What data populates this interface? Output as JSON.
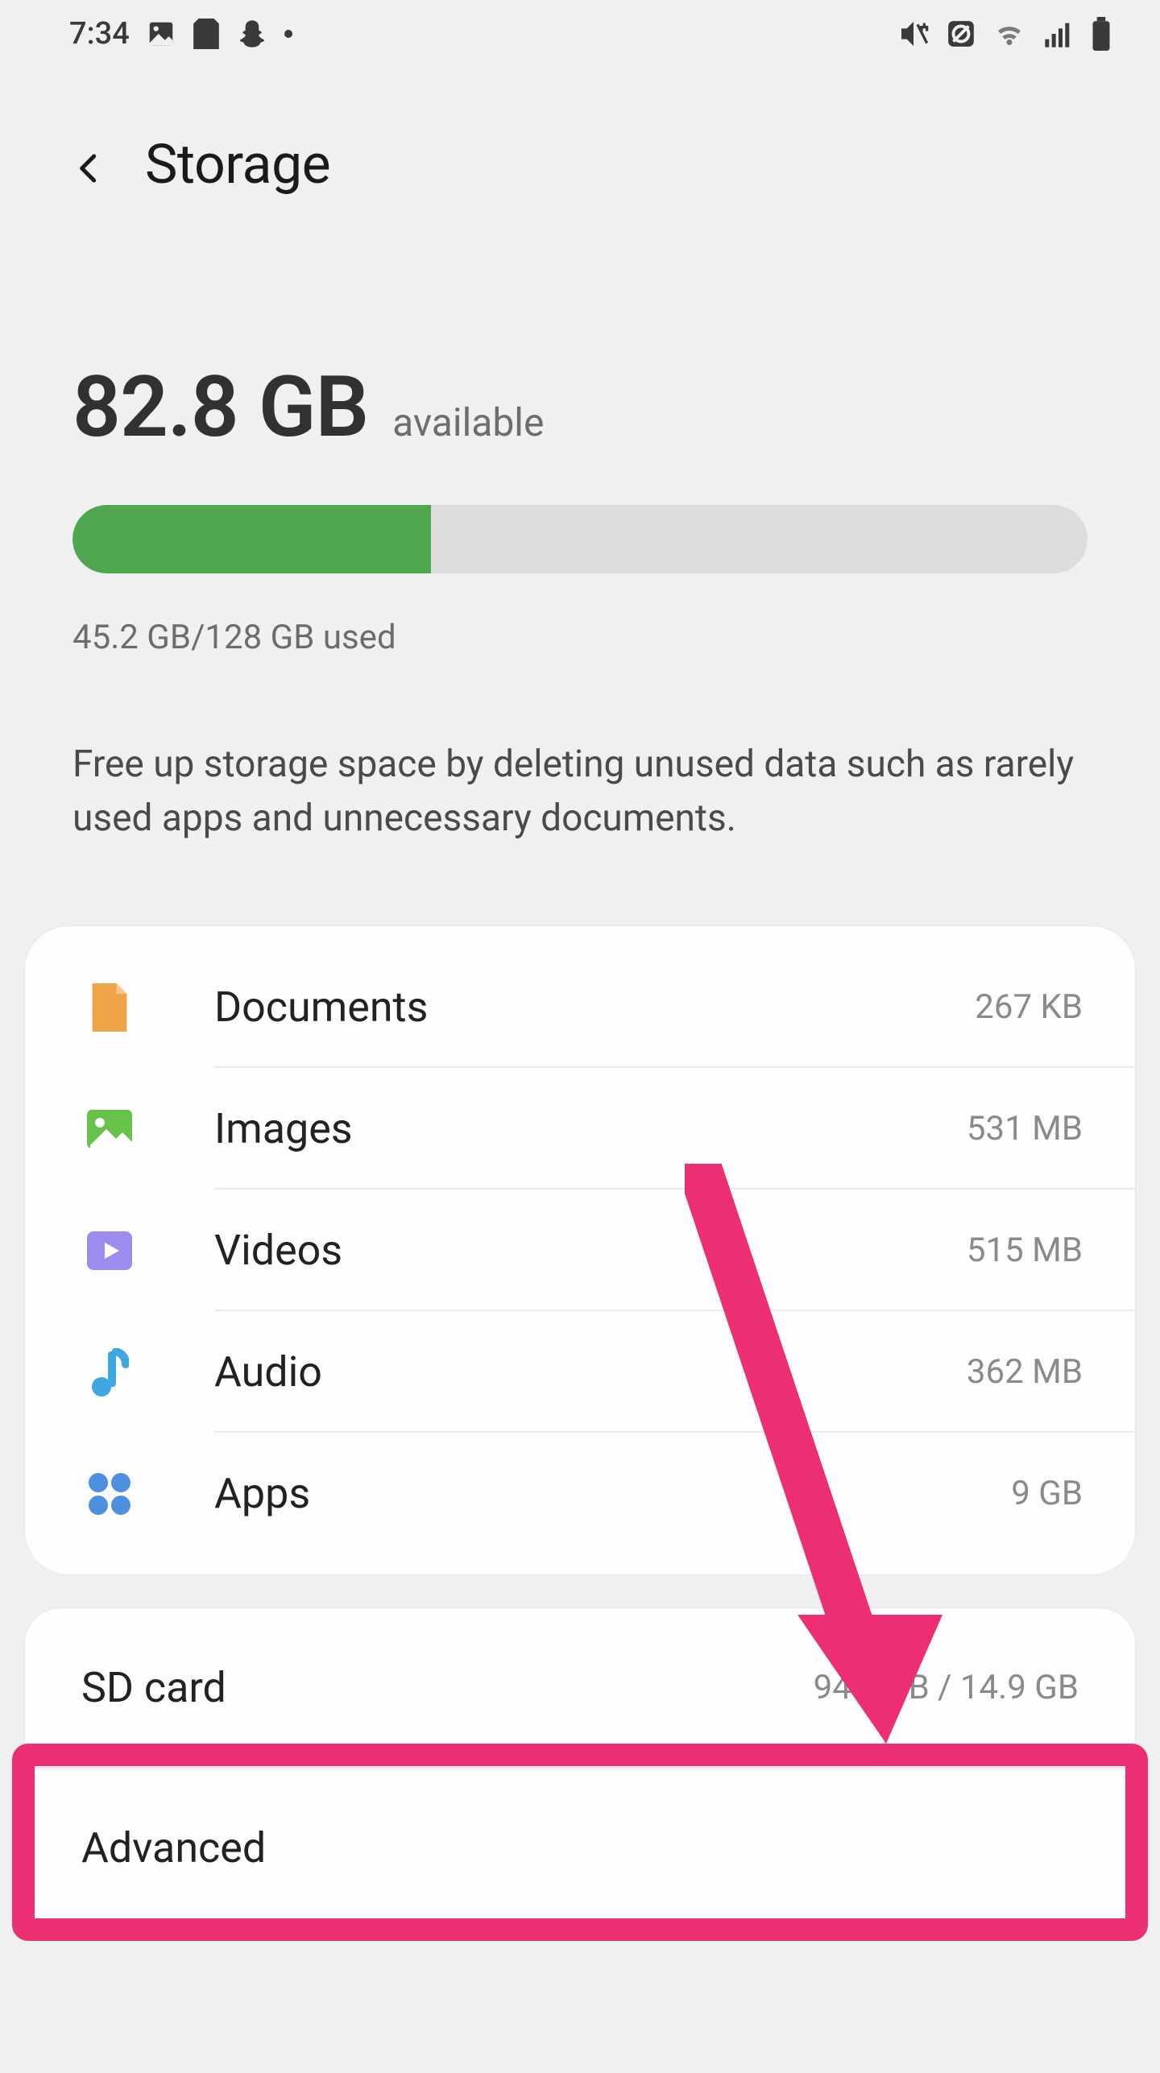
{
  "status": {
    "time": "7:34"
  },
  "header": {
    "title": "Storage"
  },
  "summary": {
    "free_amount": "82.8 GB",
    "available_label": "available",
    "usage_text": "45.2 GB/128 GB used",
    "progress_percent": 35.3,
    "hint": "Free up storage space by deleting unused data such as rarely used apps and unnecessary documents."
  },
  "categories": [
    {
      "icon": "document-icon",
      "label": "Documents",
      "size": "267 KB",
      "color": "#f0a44a"
    },
    {
      "icon": "image-icon",
      "label": "Images",
      "size": "531 MB",
      "color": "#67c24a"
    },
    {
      "icon": "video-icon",
      "label": "Videos",
      "size": "515 MB",
      "color": "#9a8def"
    },
    {
      "icon": "audio-icon",
      "label": "Audio",
      "size": "362 MB",
      "color": "#3fa8e0"
    },
    {
      "icon": "apps-icon",
      "label": "Apps",
      "size": "9 GB",
      "color": "#4f8fe0"
    }
  ],
  "bottom_rows": [
    {
      "label": "SD card",
      "size": "945 MB / 14.9 GB"
    },
    {
      "label": "Advanced",
      "size": ""
    }
  ],
  "annotation": {
    "arrow_color": "#ec2e72",
    "highlight_target": "SD card"
  }
}
